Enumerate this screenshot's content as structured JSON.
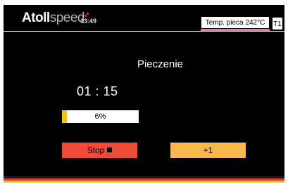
{
  "header": {
    "logo_main": "Atoll",
    "logo_suffix": "speed",
    "clock": "13:49",
    "oven_temp": "Temp. pieca 242°C",
    "tray_label": "T1"
  },
  "main": {
    "program_name": "Pieczenie",
    "remaining_time": "01 : 15",
    "progress": {
      "percent": 6,
      "label": "6%"
    }
  },
  "buttons": {
    "stop_label": "Stop",
    "plus_label": "+1"
  },
  "colors": {
    "background": "#000000",
    "progress_fill": "#f0c419",
    "stop_button": "#ee4a36",
    "plus_button": "#f7b84d",
    "temp_underline": "#e57ab0",
    "stripes": [
      "#1a1a1a",
      "#e8322b",
      "#f2c100"
    ]
  },
  "icons": {
    "status": "red-dot-icon",
    "stop": "stop-square-icon"
  }
}
